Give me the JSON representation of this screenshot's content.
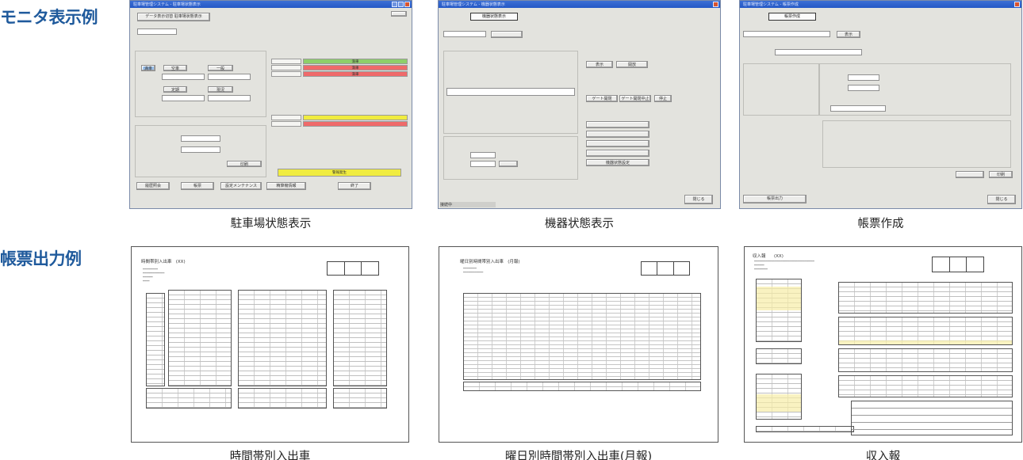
{
  "sections": {
    "monitor_title": "モニタ表示例",
    "report_title": "帳票出力例"
  },
  "monitor": {
    "parking": {
      "caption": "駐車場状態表示",
      "window_title": "駐車場管理システム - 駐車場状態表示",
      "header_button": "データ表示切替  駐車場状態表示",
      "buttons": [
        "満車",
        "空車",
        "一般",
        "定期",
        "現況",
        "警報",
        "保守モード",
        "印刷"
      ],
      "status": [
        "満車",
        "満車",
        "満車"
      ],
      "alert": "警報発生",
      "bottom_buttons": [
        "履歴照会",
        "帳票",
        "設定メンテナンス",
        "精算機情報",
        "終了"
      ]
    },
    "equipment": {
      "caption": "機器状態表示",
      "window_title": "駐車場管理システム - 機器状態表示",
      "header_button": "機器状態表示",
      "buttons": [
        "表示",
        "開放",
        "ゲート開閉",
        "ゲート開閉中止",
        "停止",
        "機器状態設定"
      ],
      "close_button": "閉じる",
      "status_bar": "接続中"
    },
    "report_making": {
      "caption": "帳票作成",
      "window_title": "駐車場管理システム - 帳票作成",
      "header_button": "帳票作成",
      "buttons": [
        "表示",
        "印刷",
        "閉じる",
        "帳票出力"
      ]
    }
  },
  "reports": {
    "hourly": {
      "caption": "時間帯別入出車",
      "title": "時間帯別入出車",
      "sub": "(XX)"
    },
    "monthly": {
      "caption": "曜日別時間帯別入出車(月報)",
      "title": "曜日別時間帯別入出車",
      "sub": "(月報)"
    },
    "income": {
      "caption": "収入報",
      "title": "収入報",
      "sub": "(XX)"
    }
  }
}
